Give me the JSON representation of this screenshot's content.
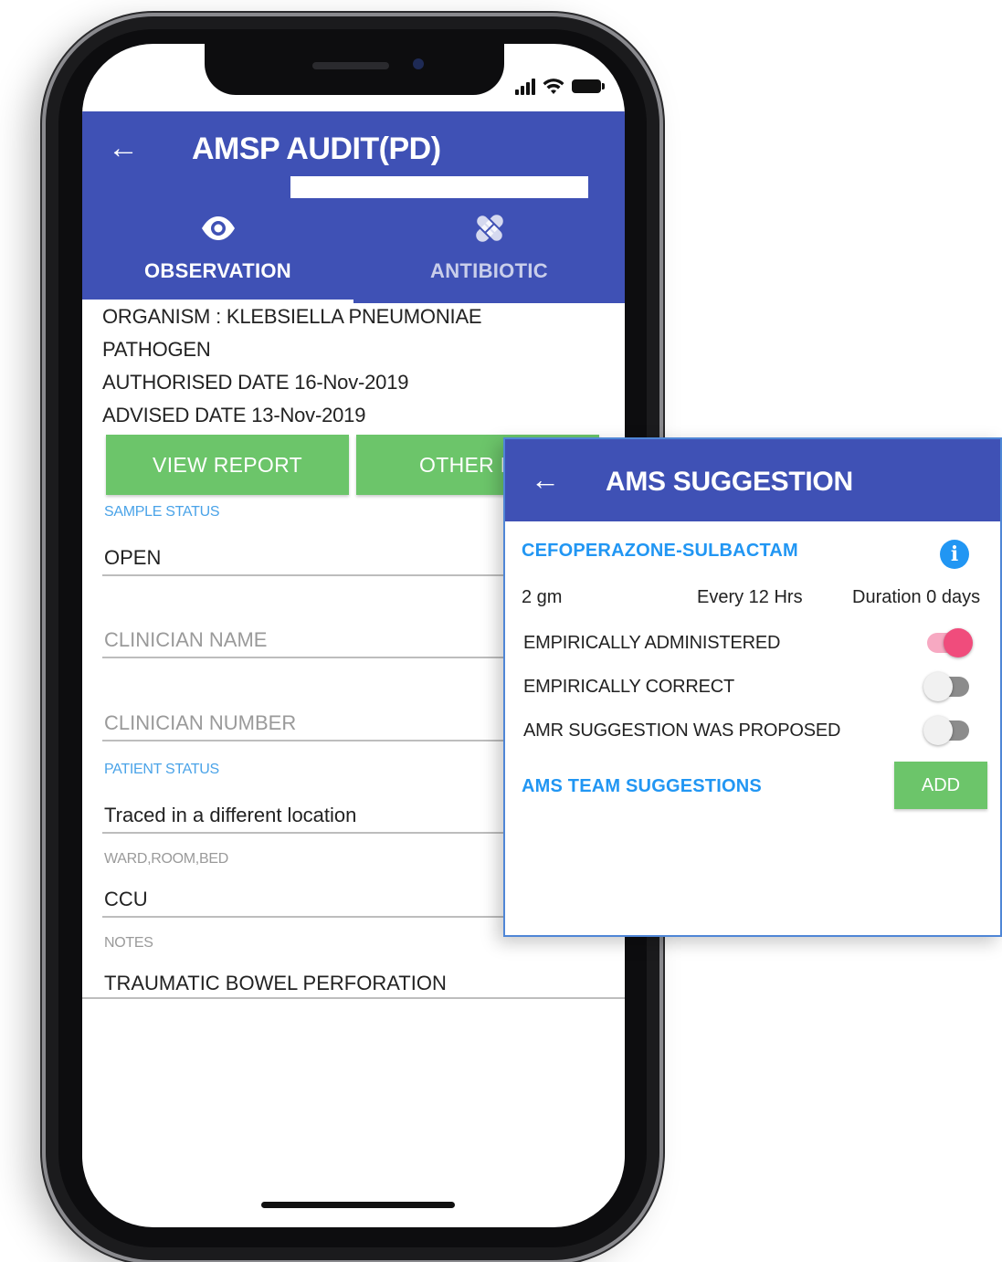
{
  "app": {
    "title": "AMSP AUDIT(PD)"
  },
  "tabs": [
    {
      "label": "OBSERVATION",
      "icon": "eye-icon",
      "active": true
    },
    {
      "label": "ANTIBIOTIC",
      "icon": "pills-icon",
      "active": false
    }
  ],
  "observation": {
    "organism": "ORGANISM : KLEBSIELLA PNEUMONIAE",
    "pathogen": "PATHOGEN",
    "authorised": "AUTHORISED DATE 16-Nov-2019",
    "advised": "ADVISED DATE 13-Nov-2019",
    "view_report_label": "VIEW REPORT",
    "other_report_label": "OTHER REI",
    "sample_status_caption": "SAMPLE STATUS",
    "sample_status_value": "OPEN",
    "clinician_name_placeholder": "CLINICIAN NAME",
    "clinician_number_placeholder": "CLINICIAN NUMBER",
    "patient_status_caption": "PATIENT STATUS",
    "patient_status_value": "Traced in a different location",
    "ward_caption": "WARD,ROOM,BED",
    "ward_value": "CCU",
    "notes_caption": "NOTES",
    "notes_value": "TRAUMATIC BOWEL PERFORATION"
  },
  "ams_suggestion": {
    "title": "AMS SUGGESTION",
    "drug": "CEFOPERAZONE-SULBACTAM",
    "dose": "2 gm",
    "frequency": "Every 12 Hrs",
    "duration": "Duration 0 days",
    "toggles": [
      {
        "label": "EMPIRICALLY ADMINISTERED",
        "on": true
      },
      {
        "label": "EMPIRICALLY CORRECT",
        "on": false
      },
      {
        "label": "AMR SUGGESTION WAS PROPOSED",
        "on": false
      }
    ],
    "team_label": "AMS TEAM SUGGESTIONS",
    "add_label": "ADD"
  },
  "colors": {
    "primary": "#3f51b5",
    "accent_green": "#6cc56a",
    "link_blue": "#2196f3",
    "toggle_on": "#f04c7c"
  }
}
